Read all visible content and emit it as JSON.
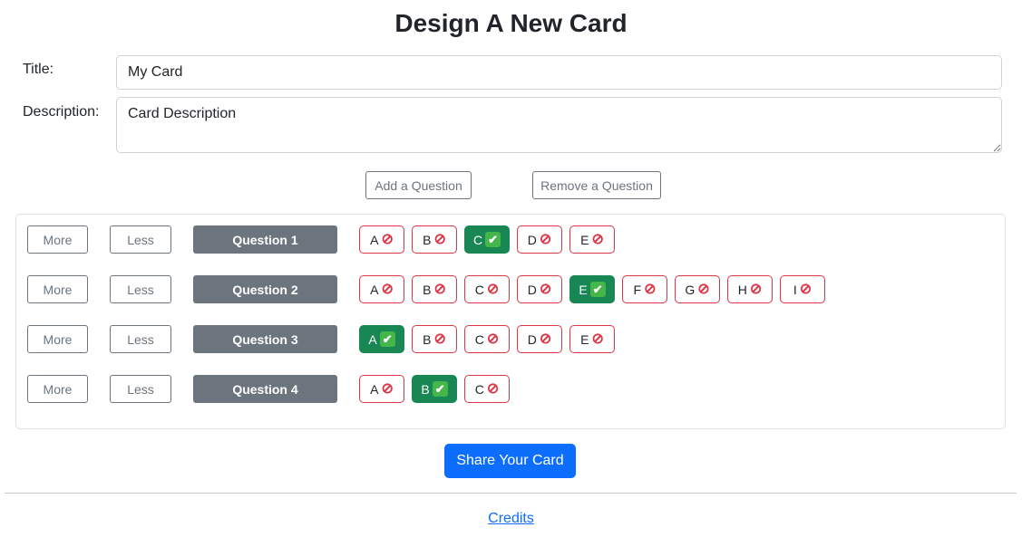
{
  "page": {
    "title": "Design A New Card"
  },
  "form": {
    "title_label": "Title:",
    "title_value": "My Card",
    "description_label": "Description:",
    "description_value": "Card Description"
  },
  "actions": {
    "add_question": "Add a Question",
    "remove_question": "Remove a Question"
  },
  "questions": [
    {
      "more": "More",
      "less": "Less",
      "title": "Question 1",
      "answers": [
        {
          "letter": "A",
          "correct": false
        },
        {
          "letter": "B",
          "correct": false
        },
        {
          "letter": "C",
          "correct": true
        },
        {
          "letter": "D",
          "correct": false
        },
        {
          "letter": "E",
          "correct": false
        }
      ]
    },
    {
      "more": "More",
      "less": "Less",
      "title": "Question 2",
      "answers": [
        {
          "letter": "A",
          "correct": false
        },
        {
          "letter": "B",
          "correct": false
        },
        {
          "letter": "C",
          "correct": false
        },
        {
          "letter": "D",
          "correct": false
        },
        {
          "letter": "E",
          "correct": true
        },
        {
          "letter": "F",
          "correct": false
        },
        {
          "letter": "G",
          "correct": false
        },
        {
          "letter": "H",
          "correct": false
        },
        {
          "letter": "I",
          "correct": false
        }
      ]
    },
    {
      "more": "More",
      "less": "Less",
      "title": "Question 3",
      "answers": [
        {
          "letter": "A",
          "correct": true
        },
        {
          "letter": "B",
          "correct": false
        },
        {
          "letter": "C",
          "correct": false
        },
        {
          "letter": "D",
          "correct": false
        },
        {
          "letter": "E",
          "correct": false
        }
      ]
    },
    {
      "more": "More",
      "less": "Less",
      "title": "Question 4",
      "answers": [
        {
          "letter": "A",
          "correct": false
        },
        {
          "letter": "B",
          "correct": true
        },
        {
          "letter": "C",
          "correct": false
        }
      ]
    }
  ],
  "icons": {
    "wrong": "prohibited-icon",
    "correct": "check-mark-button-icon"
  },
  "colors": {
    "wrong_border": "#dc3545",
    "correct_bg": "#198754",
    "primary": "#0d6efd",
    "secondary": "#6c757d"
  },
  "share_button": "Share Your Card",
  "footer": {
    "credits": "Credits"
  }
}
